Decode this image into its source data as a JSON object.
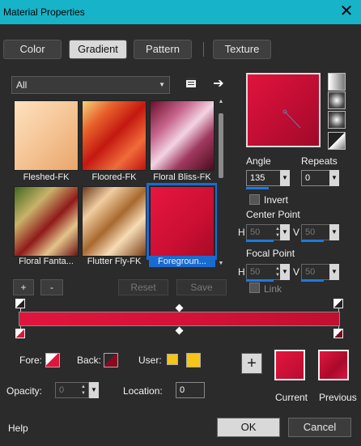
{
  "window": {
    "title": "Material Properties",
    "close_icon": "close-icon"
  },
  "tabs": [
    {
      "label": "Color",
      "active": false
    },
    {
      "label": "Gradient",
      "active": true
    },
    {
      "label": "Pattern",
      "active": false
    },
    {
      "label": "Texture",
      "active": false
    }
  ],
  "category": {
    "value": "All"
  },
  "gradients": [
    {
      "label": "Fleshed-FK"
    },
    {
      "label": "Floored-FK"
    },
    {
      "label": "Floral Bliss-FK"
    },
    {
      "label": "Floral Fanta..."
    },
    {
      "label": "Flutter Fly-FK"
    },
    {
      "label": "Foregroun...",
      "selected": true
    }
  ],
  "list_buttons": {
    "add": "+",
    "remove": "-",
    "reset": "Reset",
    "save": "Save"
  },
  "angle": {
    "label": "Angle",
    "value": "135"
  },
  "repeats": {
    "label": "Repeats",
    "value": "0"
  },
  "invert": {
    "label": "Invert",
    "checked": false
  },
  "center_point": {
    "label": "Center Point",
    "h_label": "H",
    "h_value": "50",
    "v_label": "V",
    "v_value": "50"
  },
  "focal_point": {
    "label": "Focal Point",
    "h_label": "H",
    "h_value": "50",
    "v_label": "V",
    "v_value": "50"
  },
  "link": {
    "label": "Link",
    "checked": false
  },
  "stops": {
    "fore_label": "Fore:",
    "back_label": "Back:",
    "user_label": "User:",
    "opacity_label": "Opacity:",
    "opacity_value": "0",
    "location_label": "Location:",
    "location_value": "0",
    "user_color": "#f5c518"
  },
  "swatches": {
    "current_label": "Current",
    "previous_label": "Previous",
    "add_label": "+"
  },
  "footer": {
    "help": "Help",
    "ok": "OK",
    "cancel": "Cancel"
  },
  "colors": {
    "title_bar": "#17b3c8",
    "accent": "#1a6bd0",
    "foreground": "#e0143c"
  }
}
